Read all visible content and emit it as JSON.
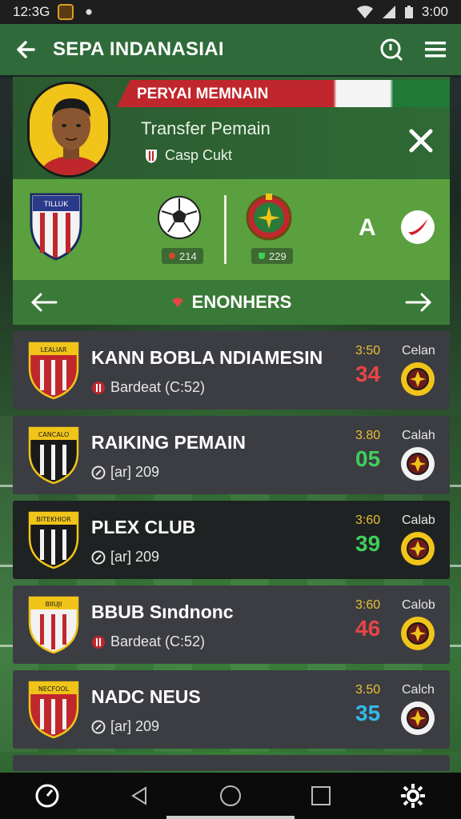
{
  "status_bar": {
    "time_left": "12:3G",
    "time_right": "3:00"
  },
  "app_bar": {
    "title": "SEPA INDANASIAI"
  },
  "transfer": {
    "ribbon": "PERYAI MEMNAIN",
    "title": "Transfer Pemain",
    "subtitle": "Casp Cukt"
  },
  "match": {
    "left_crest_text": "TILLUK",
    "chip_left": "214",
    "chip_right": "229",
    "letter": "A"
  },
  "nav": {
    "label": "ENONHERS"
  },
  "items": [
    {
      "name": "KANN BOBLA NDIAMESIN",
      "sub": "Bardeat (C:52)",
      "sub_icon": "badge-icon",
      "time": "3:50",
      "score": "34",
      "score_color": "#e84545",
      "tag": "Celan",
      "crest_text": "LEALIAR",
      "crest_color": "#c0272d",
      "badge_color": "#f0c419",
      "dark": false
    },
    {
      "name": "RAIKING PEMAIN",
      "sub": "[ar] 209",
      "sub_icon": "clock-icon",
      "time": "3.80",
      "score": "05",
      "score_color": "#3fcf5a",
      "tag": "Calah",
      "crest_text": "CANCALO",
      "crest_color": "#1a1a1a",
      "badge_color": "#f2f2f2",
      "dark": false
    },
    {
      "name": "PLEX CLUB",
      "sub": "[ar] 209",
      "sub_icon": "clock-icon",
      "time": "3:60",
      "score": "39",
      "score_color": "#3fcf5a",
      "tag": "Calab",
      "crest_text": "BITEKHIOR",
      "crest_color": "#1a1a1a",
      "badge_color": "#f0c419",
      "dark": true
    },
    {
      "name": "BBUB Sındnonc",
      "sub": "Bardeat (C:52)",
      "sub_icon": "badge-icon",
      "time": "3:60",
      "score": "46",
      "score_color": "#e84545",
      "tag": "Calob",
      "crest_text": "BIIUJI",
      "crest_color": "#f2f2f2",
      "badge_color": "#f0c419",
      "dark": false
    },
    {
      "name": "NADC NEUS",
      "sub": "[ar] 209",
      "sub_icon": "clock-icon",
      "time": "3.50",
      "score": "35",
      "score_color": "#35b8e8",
      "tag": "Calch",
      "crest_text": "NECFOOL",
      "crest_color": "#c0272d",
      "badge_color": "#f2f2f2",
      "dark": false
    }
  ],
  "colors": {
    "app_bar": "#2f6b3a",
    "accent_red": "#c0272d",
    "accent_yellow": "#f0c419"
  }
}
